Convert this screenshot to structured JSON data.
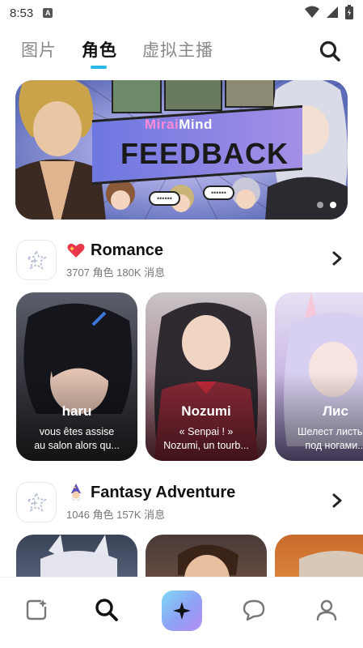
{
  "status_bar": {
    "time": "8:53",
    "notif_letter": "A"
  },
  "top_tabs": {
    "items": [
      {
        "label": "图片"
      },
      {
        "label": "角色"
      },
      {
        "label": "虚拟主播"
      }
    ],
    "active_index": 1
  },
  "banner": {
    "logo_text_a": "Mirai",
    "logo_text_b": "Mind",
    "title": "FEEDBACK",
    "bubble_a": "••••••",
    "bubble_b": "••••••",
    "slide_count": 2,
    "active_slide": 1
  },
  "sections": [
    {
      "title": "Romance",
      "emoji": "heart-sparkle",
      "meta": "3707 角色 180K 消息",
      "cards": [
        {
          "name": "haru",
          "desc": "vous êtes assise\nau salon alors qu..."
        },
        {
          "name": "Nozumi",
          "desc": "« Senpai ! »\nNozumi, un tourb..."
        },
        {
          "name": "Лис",
          "desc": "Шелест листьев\nпод ногами..."
        }
      ]
    },
    {
      "title": "Fantasy Adventure",
      "emoji": "wizard",
      "meta": "1046 角色 157K 消息",
      "cards": [
        {
          "name": "",
          "desc": ""
        },
        {
          "name": "",
          "desc": ""
        },
        {
          "name": "",
          "desc": ""
        }
      ]
    }
  ],
  "bottom_nav": [
    "sparkle-square-icon",
    "search-icon",
    "create-sparkle-icon",
    "chat-bubble-icon",
    "profile-icon"
  ],
  "colors": {
    "accent": "#2bb8e8",
    "text_primary": "#111111",
    "text_muted": "#777777",
    "border": "#e6e6ee"
  }
}
